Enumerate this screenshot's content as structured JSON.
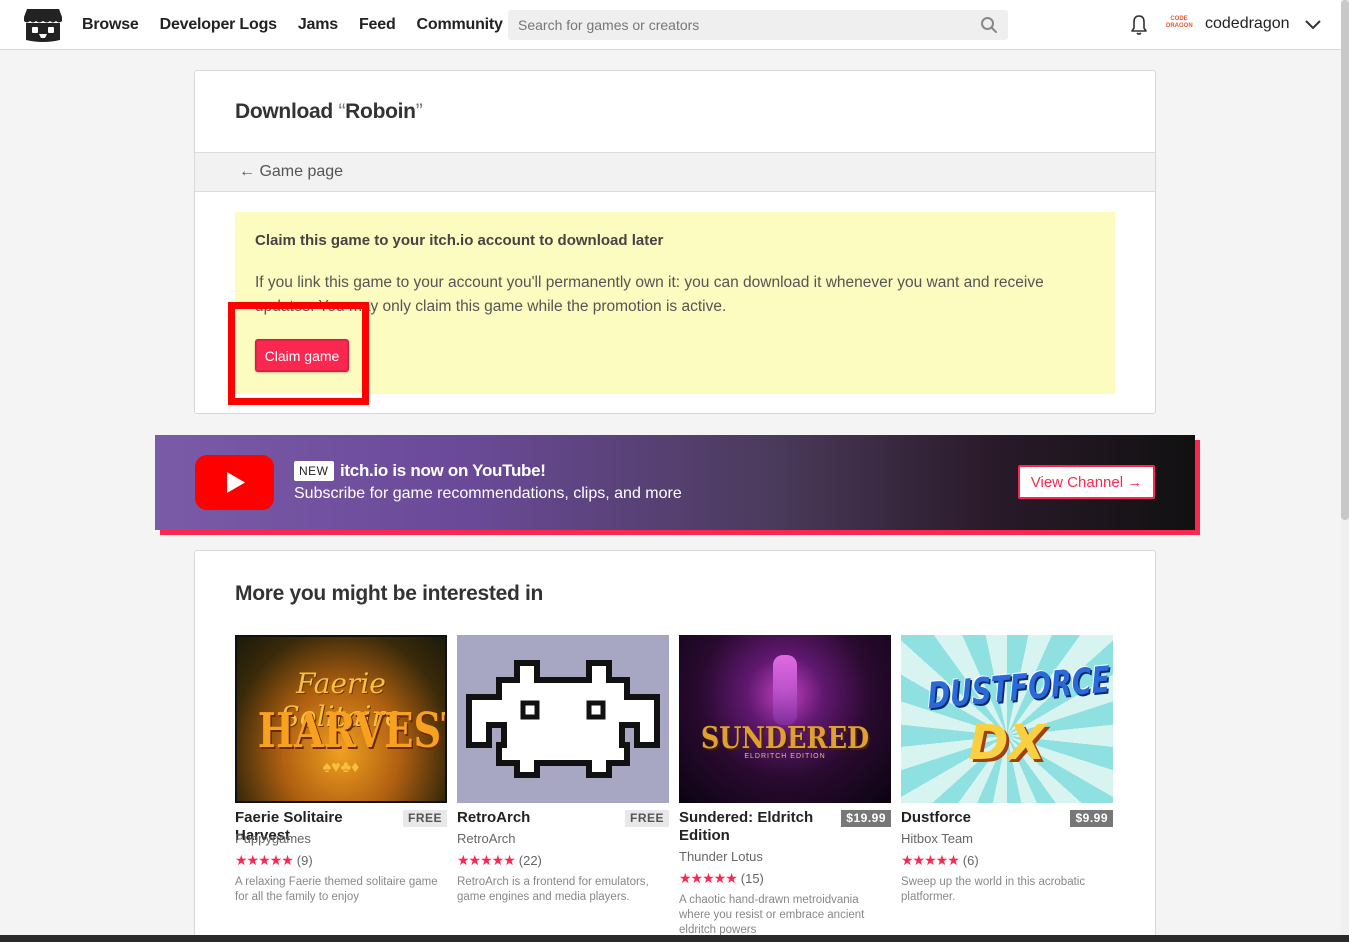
{
  "header": {
    "nav": [
      "Browse",
      "Developer Logs",
      "Jams",
      "Feed",
      "Community"
    ],
    "search_placeholder": "Search for games or creators",
    "avatar_text": "CODE DRAGON",
    "username": "codedragon"
  },
  "download": {
    "title_prefix": "Download ",
    "open_quote": "“",
    "game_name": "Roboin",
    "close_quote": "”",
    "back_link": "← Game page",
    "claim_heading": "Claim this game to your itch.io account to download later",
    "claim_text": "If you link this game to your account you'll permanently own it: you can download it whenever you want and receive updates. You may only claim this game while the promotion is active.",
    "claim_button": "Claim game"
  },
  "youtube": {
    "new_tag": "NEW",
    "title": "itch.io is now on YouTube!",
    "subtitle": "Subscribe for game recommendations, clips, and more",
    "button": "View Channel →"
  },
  "recommendations": {
    "heading": "More you might be interested in",
    "games": [
      {
        "title": "Faerie Solitaire Harvest",
        "price": "FREE",
        "author": "Puppygames",
        "stars": "★★★★★",
        "rating_count": "(9)",
        "description": "A relaxing Faerie themed solitaire game for all the family to enjoy",
        "art_line1": "Faerie Solitaire",
        "art_line2": "HARVEST",
        "art_suits": "♠♥♣♦"
      },
      {
        "title": "RetroArch",
        "price": "FREE",
        "author": "RetroArch",
        "stars": "★★★★★",
        "rating_count": "(22)",
        "description": "RetroArch is a frontend for emulators, game engines and media players."
      },
      {
        "title": "Sundered: Eldritch Edition",
        "price": "$19.99",
        "author": "Thunder Lotus",
        "stars": "★★★★★",
        "rating_count": "(15)",
        "description": "A chaotic hand-drawn metroidvania where you resist or embrace ancient eldritch powers",
        "art_line1": "SUNDERED",
        "art_line2": "ELDRITCH EDITION"
      },
      {
        "title": "Dustforce",
        "price": "$9.99",
        "author": "Hitbox Team",
        "stars": "★★★★★",
        "rating_count": "(6)",
        "description": "Sweep up the world in this acrobatic platformer.",
        "art_line1": "DUSTFORCE",
        "art_line2": "DX"
      }
    ]
  },
  "colors": {
    "accent": "#fa2850",
    "claim_box": "#fcfbc0",
    "highlight": "#ff0000"
  }
}
